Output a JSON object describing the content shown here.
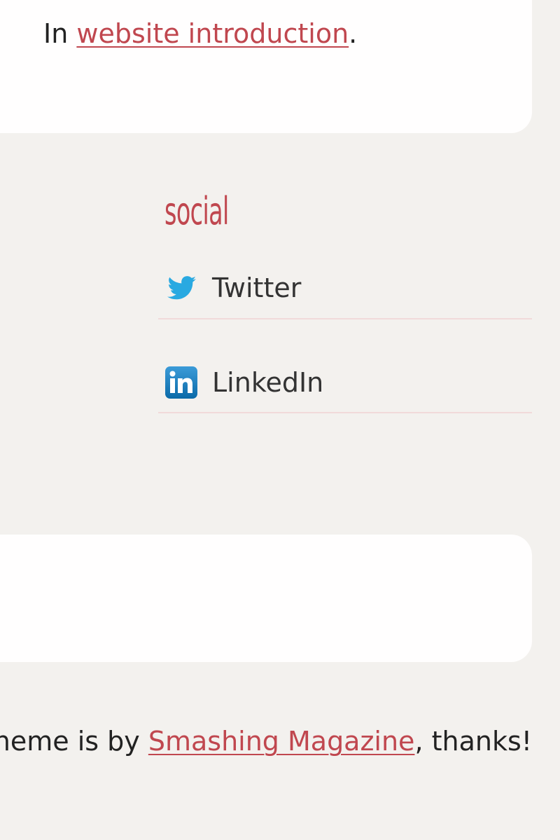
{
  "post": {
    "by_link": "",
    "in_prefix": "In",
    "category_link": "website introduction",
    "in_suffix": "."
  },
  "sidebar": {
    "widget_title": "social",
    "items": [
      {
        "label": "Twitter",
        "icon": "twitter-bird-icon"
      },
      {
        "label": "LinkedIn",
        "icon": "linkedin-icon"
      }
    ]
  },
  "footer": {
    "prefix": "theme is by",
    "link": "Smashing Magazine",
    "suffix": ", thanks!"
  },
  "colors": {
    "background": "#f3f1ee",
    "card": "#fffefe",
    "accent": "#c0474f",
    "twitter": "#29a9e1",
    "linkedin": "#0b73b3"
  }
}
